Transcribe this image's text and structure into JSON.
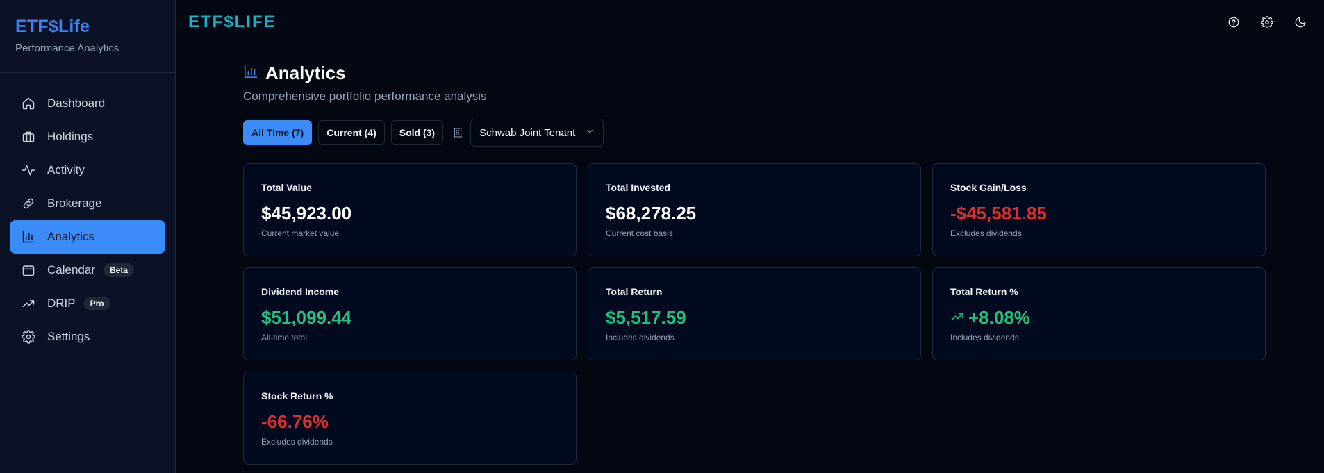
{
  "brand": {
    "title": "ETF$Life",
    "subtitle": "Performance Analytics"
  },
  "nav": {
    "items": [
      {
        "label": "Dashboard",
        "icon": "home-icon"
      },
      {
        "label": "Holdings",
        "icon": "briefcase-icon"
      },
      {
        "label": "Activity",
        "icon": "activity-icon"
      },
      {
        "label": "Brokerage",
        "icon": "link-icon"
      },
      {
        "label": "Analytics",
        "icon": "bar-chart-icon",
        "active": true
      },
      {
        "label": "Calendar",
        "icon": "calendar-icon",
        "badge": "Beta"
      },
      {
        "label": "DRIP",
        "icon": "trending-up-icon",
        "badge": "Pro"
      },
      {
        "label": "Settings",
        "icon": "gear-icon"
      }
    ]
  },
  "topbar": {
    "logo": "ETF$LIFE",
    "icons": [
      "help-icon",
      "gear-icon",
      "moon-icon"
    ]
  },
  "page": {
    "title": "Analytics",
    "subtitle": "Comprehensive portfolio performance analysis",
    "filters": [
      "All Time (7)",
      "Current (4)",
      "Sold (3)"
    ],
    "active_filter": 0,
    "account_select": "Schwab Joint Tenant"
  },
  "cards": [
    {
      "label": "Total Value",
      "value": "$45,923.00",
      "sub": "Current market value",
      "tone": "neutral"
    },
    {
      "label": "Total Invested",
      "value": "$68,278.25",
      "sub": "Current cost basis",
      "tone": "neutral"
    },
    {
      "label": "Stock Gain/Loss",
      "value": "-$45,581.85",
      "sub": "Excludes dividends",
      "tone": "negative"
    },
    {
      "label": "Dividend Income",
      "value": "$51,099.44",
      "sub": "All-time total",
      "tone": "positive"
    },
    {
      "label": "Total Return",
      "value": "$5,517.59",
      "sub": "Includes dividends",
      "tone": "positive"
    },
    {
      "label": "Total Return %",
      "value": "+8.08%",
      "sub": "Includes dividends",
      "tone": "positive",
      "icon": "trending-up-icon"
    },
    {
      "label": "Stock Return %",
      "value": "-66.76%",
      "sub": "Excludes dividends",
      "tone": "negative"
    }
  ],
  "colors": {
    "positive": "#1fc27f",
    "negative": "#e02d2d",
    "neutral": "#ffffff",
    "accent": "#3b8cf7",
    "logo": "#17b3c9"
  }
}
